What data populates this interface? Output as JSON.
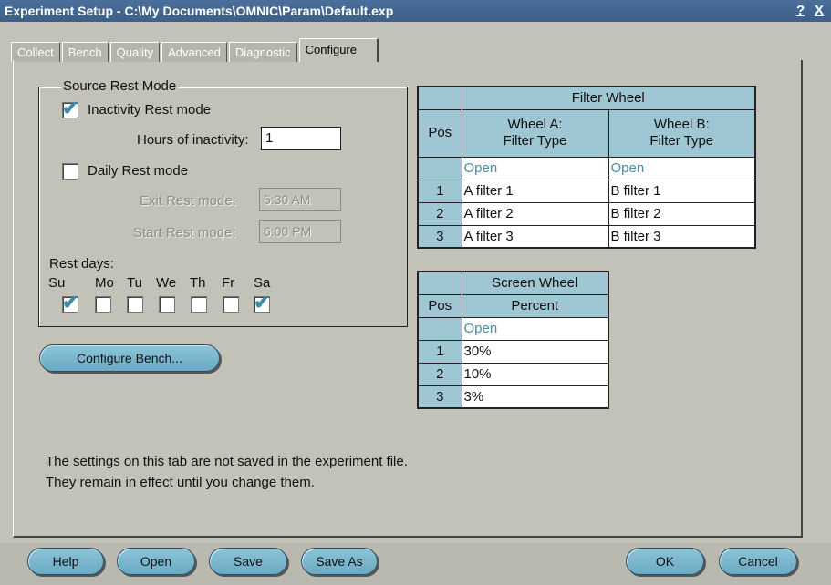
{
  "window": {
    "title": "Experiment Setup - C:\\My Documents\\OMNIC\\Param\\Default.exp",
    "help_glyph": "?",
    "close_glyph": "X"
  },
  "tabs": [
    "Collect",
    "Bench",
    "Quality",
    "Advanced",
    "Diagnostic",
    "Configure"
  ],
  "active_tab": "Configure",
  "source_rest": {
    "legend": "Source Rest Mode",
    "inactivity_label": "Inactivity Rest mode",
    "inactivity_checked": true,
    "hours_label": "Hours of inactivity:",
    "hours_value": "1",
    "daily_label": "Daily Rest mode",
    "daily_checked": false,
    "exit_label": "Exit Rest mode:",
    "exit_value": "5:30 AM",
    "start_label": "Start Rest mode:",
    "start_value": "6:00 PM",
    "rest_days_label": "Rest days:",
    "days": [
      {
        "label": "Su",
        "checked": true
      },
      {
        "label": "Mo",
        "checked": false
      },
      {
        "label": "Tu",
        "checked": false
      },
      {
        "label": "We",
        "checked": false
      },
      {
        "label": "Th",
        "checked": false
      },
      {
        "label": "Fr",
        "checked": false
      },
      {
        "label": "Sa",
        "checked": true
      }
    ]
  },
  "configure_bench_label": "Configure Bench...",
  "filter_wheel": {
    "title": "Filter Wheel",
    "pos_header": "Pos",
    "col_a": "Wheel A:\nFilter Type",
    "col_b": "Wheel B:\nFilter Type",
    "rows": [
      {
        "pos": "",
        "a": "Open",
        "b": "Open"
      },
      {
        "pos": "1",
        "a": "A filter 1",
        "b": "B filter 1"
      },
      {
        "pos": "2",
        "a": "A filter 2",
        "b": "B filter 2"
      },
      {
        "pos": "3",
        "a": "A filter 3",
        "b": "B filter 3"
      }
    ]
  },
  "screen_wheel": {
    "title": "Screen Wheel",
    "pos_header": "Pos",
    "col": "Percent",
    "rows": [
      {
        "pos": "",
        "value": "Open"
      },
      {
        "pos": "1",
        "value": "30%"
      },
      {
        "pos": "2",
        "value": "10%"
      },
      {
        "pos": "3",
        "value": "3%"
      }
    ]
  },
  "note_line1": "The settings on this tab are not saved in the experiment file.",
  "note_line2": "They remain in effect until you change them.",
  "buttons": {
    "help": "Help",
    "open": "Open",
    "save": "Save",
    "save_as": "Save As",
    "ok": "OK",
    "cancel": "Cancel"
  },
  "colors": {
    "accent": "#3f8aa6",
    "button_fill": "#7ab8cd",
    "table_header": "#9fc6d3",
    "titlebar": "#46698f"
  }
}
